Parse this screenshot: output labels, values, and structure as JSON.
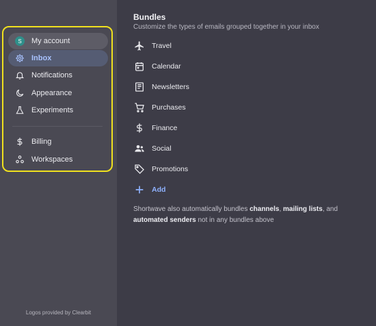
{
  "sidebar": {
    "account": {
      "avatar_letter": "S",
      "label": "My account"
    },
    "items": [
      {
        "label": "Inbox",
        "icon": "gear-icon"
      },
      {
        "label": "Notifications",
        "icon": "bell-icon"
      },
      {
        "label": "Appearance",
        "icon": "moon-icon"
      },
      {
        "label": "Experiments",
        "icon": "flask-icon"
      },
      {
        "label": "Billing",
        "icon": "dollar-icon"
      },
      {
        "label": "Workspaces",
        "icon": "workspaces-icon"
      }
    ],
    "footer": "Logos provided by Clearbit"
  },
  "main": {
    "title": "Bundles",
    "subtitle": "Customize the types of emails grouped together in your inbox",
    "bundles": [
      {
        "label": "Travel",
        "icon": "airplane-icon"
      },
      {
        "label": "Calendar",
        "icon": "calendar-icon"
      },
      {
        "label": "Newsletters",
        "icon": "newsletter-icon"
      },
      {
        "label": "Purchases",
        "icon": "cart-icon"
      },
      {
        "label": "Finance",
        "icon": "dollar-icon"
      },
      {
        "label": "Social",
        "icon": "people-icon"
      },
      {
        "label": "Promotions",
        "icon": "tag-icon"
      }
    ],
    "add_label": "Add",
    "note": {
      "prefix": "Shortwave also automatically bundles ",
      "bold1": "channels",
      "sep": ", ",
      "bold2": "mailing lists",
      "mid": ", and ",
      "bold3": "automated senders",
      "suffix": " not in any bundles above"
    }
  },
  "colors": {
    "background": "#3d3c47",
    "sidebar": "#4a4953",
    "accent": "#8fb2ff",
    "highlight": "#f0e11e"
  }
}
